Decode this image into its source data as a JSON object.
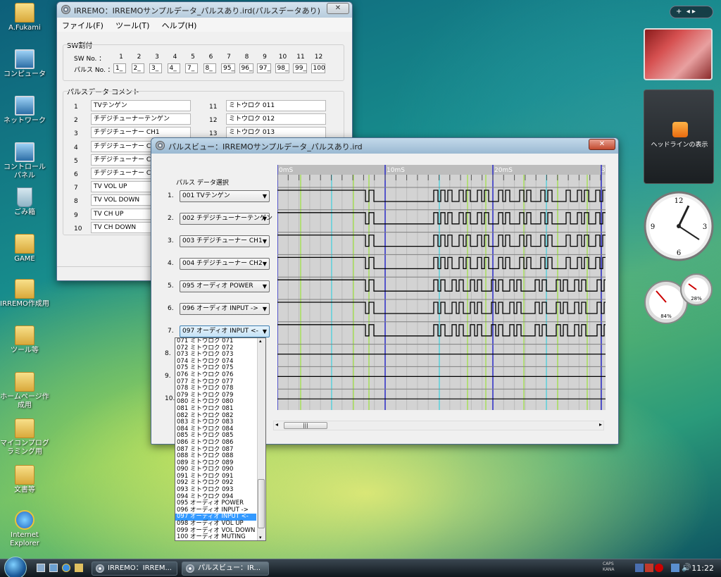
{
  "desktop": {
    "icons": [
      {
        "label": "A.Fukami"
      },
      {
        "label": "コンピュータ"
      },
      {
        "label": "ネットワーク"
      },
      {
        "label": "コントロール パネル"
      },
      {
        "label": "ごみ箱"
      },
      {
        "label": "GAME"
      },
      {
        "label": "IRREMO作成用"
      },
      {
        "label": "ツール等"
      },
      {
        "label": "ホームページ作成用"
      },
      {
        "label": "マイコンプログラミング用"
      },
      {
        "label": "文書等"
      },
      {
        "label": "Internet Explorer"
      }
    ]
  },
  "main_window": {
    "title": "IRREMO：IRREMOサンプルデータ_パルスあり.ird(パルスデータあり)",
    "menu": [
      "ファイル(F)",
      "ツール(T)",
      "ヘルプ(H)"
    ],
    "sw_group_label": "SW割付",
    "sw_label": "SW No. ：",
    "pulse_label": "パルス No. ：",
    "sw_numbers": [
      "1",
      "2",
      "3",
      "4",
      "5",
      "6",
      "7",
      "8",
      "9",
      "10",
      "11",
      "12"
    ],
    "pulse_numbers": [
      "1_",
      "2_",
      "3_",
      "4_",
      "7_",
      "8_",
      "95_",
      "96_",
      "97_",
      "98_",
      "99_",
      "100"
    ],
    "comment_group_label": "パルスデータ コメント",
    "comments_left": [
      {
        "no": "1",
        "text": "TVテンゲン"
      },
      {
        "no": "2",
        "text": "チデジチューナーテンゲン"
      },
      {
        "no": "3",
        "text": "チデジチューナー CH1"
      },
      {
        "no": "4",
        "text": "チデジチューナー CH2"
      },
      {
        "no": "5",
        "text": "チデジチューナー CH3"
      },
      {
        "no": "6",
        "text": "チデジチューナー CH4"
      },
      {
        "no": "7",
        "text": "TV VOL UP"
      },
      {
        "no": "8",
        "text": "TV VOL DOWN"
      },
      {
        "no": "9",
        "text": "TV CH UP"
      },
      {
        "no": "10",
        "text": "TV CH DOWN"
      }
    ],
    "comments_right": [
      {
        "no": "11",
        "text": "ミトウロク 011"
      },
      {
        "no": "12",
        "text": "ミトウロク 012"
      },
      {
        "no": "13",
        "text": "ミトウロク 013"
      }
    ]
  },
  "pulse_window": {
    "title": "パルスビュー：IRREMOサンプルデータ_パルスあり.ird",
    "select_label": "パルス データ選択",
    "selectors": [
      {
        "no": "1.",
        "value": "001  TVテンゲン"
      },
      {
        "no": "2.",
        "value": "002  チデジチューナーテンゲン"
      },
      {
        "no": "3.",
        "value": "003  チデジチューナー CH1"
      },
      {
        "no": "4.",
        "value": "004  チデジチューナー CH2"
      },
      {
        "no": "5.",
        "value": "095  オーディオ POWER"
      },
      {
        "no": "6.",
        "value": "096  オーディオ INPUT ->"
      },
      {
        "no": "7.",
        "value": "097  オーディオ INPUT <-"
      }
    ],
    "extra_rows": [
      "8.",
      "9.",
      "10."
    ],
    "time_labels": [
      "0mS",
      "10mS",
      "20mS",
      "3"
    ],
    "dropdown_items": [
      "071  ミトウロク 071",
      "072  ミトウロク 072",
      "073  ミトウロク 073",
      "074  ミトウロク 074",
      "075  ミトウロク 075",
      "076  ミトウロク 076",
      "077  ミトウロク 077",
      "078  ミトウロク 078",
      "079  ミトウロク 079",
      "080  ミトウロク 080",
      "081  ミトウロク 081",
      "082  ミトウロク 082",
      "083  ミトウロク 083",
      "084  ミトウロク 084",
      "085  ミトウロク 085",
      "086  ミトウロク 086",
      "087  ミトウロク 087",
      "088  ミトウロク 088",
      "089  ミトウロク 089",
      "090  ミトウロク 090",
      "091  ミトウロク 091",
      "092  ミトウロク 092",
      "093  ミトウロク 093",
      "094  ミトウロク 094",
      "095  オーディオ POWER",
      "096  オーディオ INPUT ->",
      "097  オーディオ INPUT <-",
      "098  オーディオ VOL UP",
      "099  オーディオ VOL DOWN",
      "100  オーディオ MUTING"
    ],
    "dropdown_selected_index": 26
  },
  "sidebar": {
    "headline_text": "ヘッドラインの表示",
    "cpu_percent": "84%",
    "mem_percent": "28%"
  },
  "taskbar": {
    "buttons": [
      "IRREMO：IRREM...",
      "パルスビュー：IR..."
    ],
    "time": "11:22",
    "caps": "CAPS",
    "kana": "KANA"
  }
}
